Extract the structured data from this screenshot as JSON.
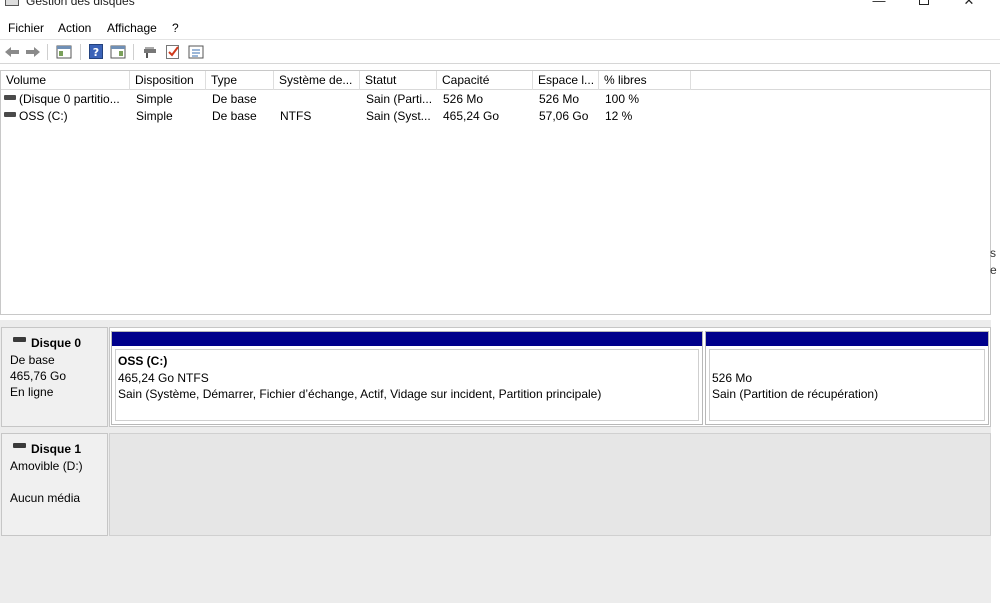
{
  "window": {
    "title": "Gestion des disques",
    "minimize": "—",
    "close": "✕"
  },
  "menu": {
    "items": [
      "Fichier",
      "Action",
      "Affichage",
      "?"
    ]
  },
  "toolbar": {
    "icons": [
      "back-arrow-icon",
      "forward-arrow-icon",
      "console-tree-icon",
      "help-icon",
      "properties-icon",
      "rescan-icon",
      "check-icon",
      "list-icon"
    ]
  },
  "volume_list": {
    "columns": [
      "Volume",
      "Disposition",
      "Type",
      "Système de...",
      "Statut",
      "Capacité",
      "Espace l...",
      "% libres"
    ],
    "rows": [
      {
        "volume": "(Disque 0 partitio...",
        "disposition": "Simple",
        "type": "De base",
        "fs": "",
        "status": "Sain (Parti...",
        "capacity": "526 Mo",
        "free": "526 Mo",
        "pct": "100 %"
      },
      {
        "volume": "OSS (C:)",
        "disposition": "Simple",
        "type": "De base",
        "fs": "NTFS",
        "status": "Sain (Syst...",
        "capacity": "465,24 Go",
        "free": "57,06 Go",
        "pct": "12 %"
      }
    ]
  },
  "right_edge": {
    "a": "s",
    "b": "e"
  },
  "disks": [
    {
      "name": "Disque 0",
      "kind": "De base",
      "size": "465,76 Go",
      "state": "En ligne",
      "partitions": [
        {
          "title": "OSS  (C:)",
          "size": "465,24 Go NTFS",
          "status": "Sain (Système, Démarrer, Fichier d’échange, Actif, Vidage sur incident, Partition principale)"
        },
        {
          "title": "",
          "size": "526 Mo",
          "status": "Sain (Partition de récupération)"
        }
      ]
    },
    {
      "name": "Disque 1",
      "kind": "Amovible (D:)",
      "media": "Aucun média"
    }
  ],
  "colors": {
    "partition_bar": "#00008b"
  }
}
